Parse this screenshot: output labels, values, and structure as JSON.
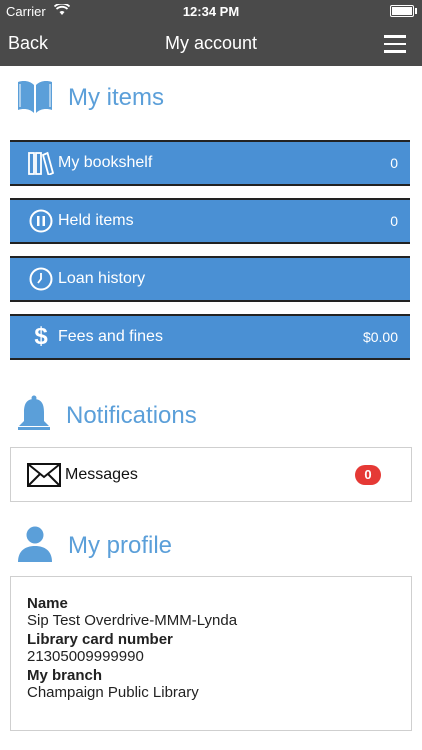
{
  "status": {
    "carrier": "Carrier",
    "time": "12:34 PM"
  },
  "nav": {
    "back": "Back",
    "title": "My account"
  },
  "my_items": {
    "title": "My items",
    "rows": [
      {
        "label": "My bookshelf",
        "value": "0",
        "icon": "bookshelf-icon"
      },
      {
        "label": "Held items",
        "value": "0",
        "icon": "pause-icon"
      },
      {
        "label": "Loan history",
        "value": "",
        "icon": "clock-icon"
      },
      {
        "label": "Fees and fines",
        "value": "$0.00",
        "icon": "dollar-icon"
      }
    ]
  },
  "notifications": {
    "title": "Notifications",
    "messages_label": "Messages",
    "messages_count": "0"
  },
  "profile": {
    "title": "My profile",
    "name_label": "Name",
    "name_value": "Sip Test Overdrive-MMM-Lynda",
    "card_label": "Library card number",
    "card_value": "21305009999990",
    "branch_label": "My branch",
    "branch_value": "Champaign Public Library"
  },
  "colors": {
    "accent": "#5b9fd9",
    "row_bg": "#4a90d4",
    "nav_bg": "#4a4a4a",
    "badge": "#e53935"
  }
}
